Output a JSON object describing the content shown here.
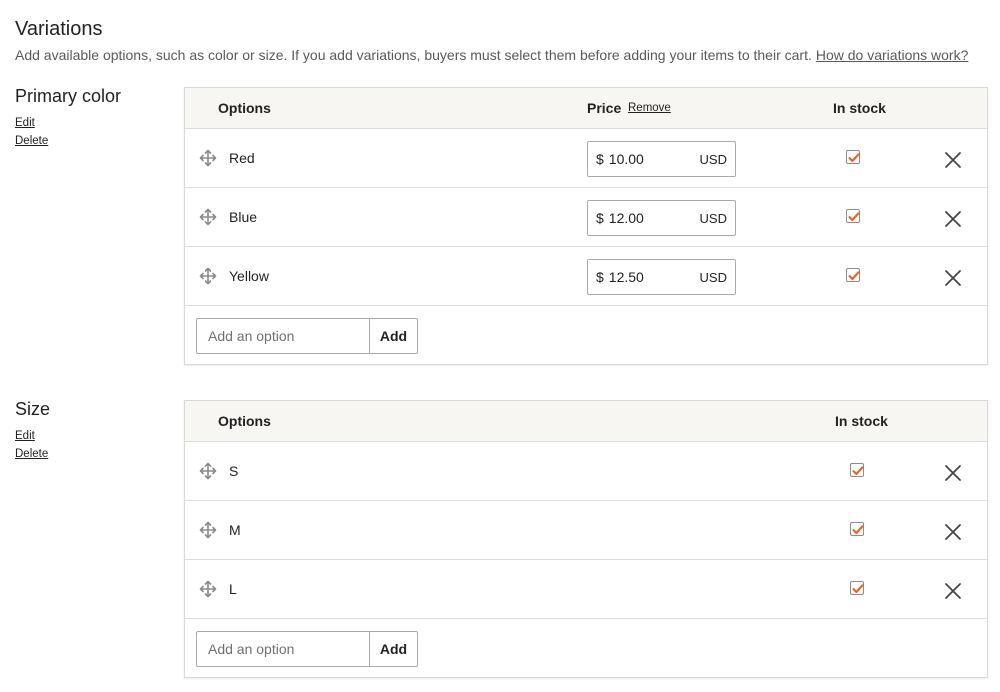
{
  "page": {
    "title": "Variations",
    "intro": "Add available options, such as color or size. If you add variations, buyers must select them before adding your items to their cart.",
    "help_link": "How do variations work?"
  },
  "colors": {
    "check_accent": "#f1641e",
    "header_bg": "#f7f6f2",
    "border": "#d9d9d9"
  },
  "icons": {
    "drag": "move-arrows-icon",
    "check": "checkmark-icon",
    "delete": "close-x-icon"
  },
  "variations": [
    {
      "name": "Primary color",
      "edit_label": "Edit",
      "delete_label": "Delete",
      "columns": {
        "options": "Options",
        "price": "Price",
        "remove": "Remove",
        "in_stock": "In stock"
      },
      "rows": [
        {
          "label": "Red",
          "currency": "$",
          "price": "10.00",
          "unit": "USD",
          "in_stock": true
        },
        {
          "label": "Blue",
          "currency": "$",
          "price": "12.00",
          "unit": "USD",
          "in_stock": true
        },
        {
          "label": "Yellow",
          "currency": "$",
          "price": "12.50",
          "unit": "USD",
          "in_stock": true
        }
      ],
      "add_placeholder": "Add an option",
      "add_label": "Add"
    },
    {
      "name": "Size",
      "edit_label": "Edit",
      "delete_label": "Delete",
      "columns": {
        "options": "Options",
        "in_stock": "In stock"
      },
      "rows": [
        {
          "label": "S",
          "in_stock": true
        },
        {
          "label": "M",
          "in_stock": true
        },
        {
          "label": "L",
          "in_stock": true
        }
      ],
      "add_placeholder": "Add an option",
      "add_label": "Add"
    }
  ]
}
